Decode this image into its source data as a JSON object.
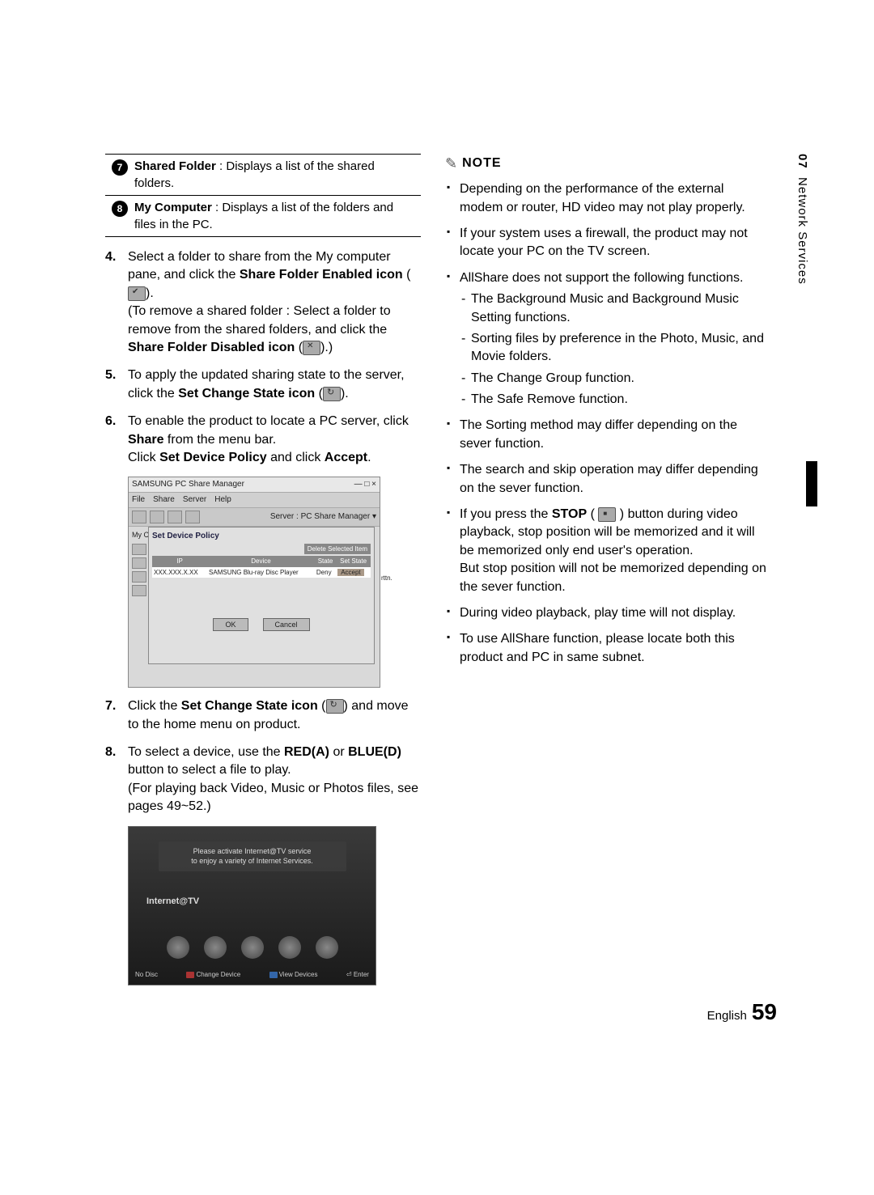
{
  "side_tab": {
    "num": "07",
    "title": "Network Services"
  },
  "circles": [
    {
      "n": "7",
      "bold": "Shared Folder",
      "rest": " : Displays a list of the shared folders."
    },
    {
      "n": "8",
      "bold": "My Computer",
      "rest": " : Displays a list of the folders and files in the PC."
    }
  ],
  "steps": {
    "s4_a": "Select a folder to share from the My computer pane, and click the ",
    "s4_b": "Share Folder Enabled icon",
    "s4_c": " (",
    "s4_d": ").",
    "s4_e": "(To remove a shared folder : Select a folder to remove from the shared folders, and click the ",
    "s4_f": "Share Folder Disabled icon",
    "s4_g": " (",
    "s4_h": ").)",
    "s5_a": "To apply the updated sharing state to the server, click the ",
    "s5_b": "Set Change State icon",
    "s5_c": " (",
    "s5_d": ").",
    "s6_a": "To enable the product to locate a PC server, click ",
    "s6_b": "Share",
    "s6_c": " from the menu bar.",
    "s6_d": "Click ",
    "s6_e": "Set Device Policy",
    "s6_f": " and click ",
    "s6_g": "Accept",
    "s6_h": ".",
    "s7_a": "Click the ",
    "s7_b": "Set Change State icon",
    "s7_c": " (",
    "s7_d": ") and move to the home menu on product.",
    "s8_a": "To select a device, use the ",
    "s8_b": "RED(A)",
    "s8_c": " or ",
    "s8_d": "BLUE(D)",
    "s8_e": " button to select a file to play.",
    "s8_f": "(For playing back Video, Music or Photos files, see pages 49~52.)"
  },
  "dialog": {
    "title": "SAMSUNG PC Share Manager",
    "menu": [
      "File",
      "Share",
      "Server",
      "Help"
    ],
    "server_label": "Server : PC Share Manager ▾",
    "side": "My Co",
    "rtin": "rttn.",
    "popup_title": "Set Device Policy",
    "delete_btn": "Delete Selected Item",
    "headers": [
      "IP",
      "Device",
      "State",
      "Set State"
    ],
    "row": {
      "ip": "XXX.XXX.X.XX",
      "device": "SAMSUNG Blu-ray Disc Player",
      "state": "Deny",
      "action": "Accept"
    },
    "ok": "OK",
    "cancel": "Cancel"
  },
  "tv": {
    "msg1": "Please activate Internet@TV service",
    "msg2": "to enjoy a variety of Internet Services.",
    "label": "Internet@TV",
    "bar": {
      "nodisc": "No Disc",
      "a": "Change Device",
      "d": "View Devices",
      "enter": "Enter"
    }
  },
  "note_title": "NOTE",
  "notes": {
    "n1": "Depending on the performance of the external modem or router, HD video may not play properly.",
    "n2": "If your system uses a firewall, the product may not locate your PC on the TV screen.",
    "n3": "AllShare does not support the following functions.",
    "n3a": "The Background Music and Background Music Setting functions.",
    "n3b": "Sorting files by preference in the Photo, Music, and Movie folders.",
    "n3c": "The Change Group function.",
    "n3d": "The Safe Remove function.",
    "n4": "The Sorting method may differ depending on the sever function.",
    "n5": "The search and skip operation may differ depending on the sever function.",
    "n6a": "If you press the ",
    "n6b": "STOP",
    "n6c": " ( ",
    "n6d": " ) button during video playback, stop position will be memorized and it will be memorized only end user's operation.",
    "n6e": "But stop position will not be memorized depending on the sever function.",
    "n7": "During video playback, play time will not display.",
    "n8": "To use AllShare function, please locate both this product and PC in same subnet."
  },
  "footer": {
    "lang": "English",
    "page": "59"
  }
}
